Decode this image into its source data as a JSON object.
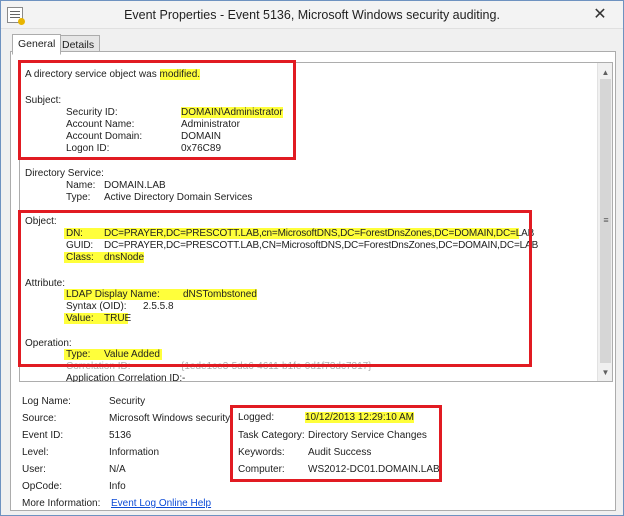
{
  "window": {
    "title": "Event Properties - Event 5136, Microsoft Windows security auditing.",
    "close_glyph": "✕"
  },
  "tabs": [
    {
      "label": "General",
      "active": true
    },
    {
      "label": "Details",
      "active": false
    }
  ],
  "description": {
    "intro_prefix": "A directory service object was ",
    "intro_highlight": "modified.",
    "subject": {
      "heading": "Subject:",
      "security_id_label": "Security ID:",
      "security_id_value": "DOMAIN\\Administrator",
      "account_name_label": "Account Name:",
      "account_name_value": "Administrator",
      "account_domain_label": "Account Domain:",
      "account_domain_value": "DOMAIN",
      "logon_id_label": "Logon ID:",
      "logon_id_value": "0x76C89"
    },
    "directory_service": {
      "heading": "Directory Service:",
      "name_label": "Name:",
      "name_value": "DOMAIN.LAB",
      "type_label": "Type:",
      "type_value": "Active Directory Domain Services"
    },
    "object": {
      "heading": "Object:",
      "dn_label": "DN:",
      "dn_value": "DC=PRAYER,DC=PRESCOTT.LAB,cn=MicrosoftDNS,DC=ForestDnsZones,DC=DOMAIN,DC=LAB",
      "guid_label": "GUID:",
      "guid_value": "DC=PRAYER,DC=PRESCOTT.LAB,CN=MicrosoftDNS,DC=ForestDnsZones,DC=DOMAIN,DC=LAB",
      "class_label": "Class:",
      "class_value": "dnsNode"
    },
    "attribute": {
      "heading": "Attribute:",
      "ldap_label": "LDAP Display Name:",
      "ldap_value": "dNSTombstoned",
      "syntax_label": "Syntax (OID):",
      "syntax_value": "2.5.5.8",
      "value_label": "Value:",
      "value_value": "TRUE"
    },
    "operation": {
      "heading": "Operation:",
      "type_label": "Type:",
      "type_value": "Value Added",
      "correlation_label": "Correlation ID:",
      "correlation_value": "{1ede1ce3-5da6-4611-b1fe-0d1f73dc7317}",
      "app_correlation_label": "Application Correlation ID:",
      "app_correlation_value": "-"
    }
  },
  "details": {
    "log_name_label": "Log Name:",
    "log_name_value": "Security",
    "source_label": "Source:",
    "source_value": "Microsoft Windows security",
    "event_id_label": "Event ID:",
    "event_id_value": "5136",
    "level_label": "Level:",
    "level_value": "Information",
    "user_label": "User:",
    "user_value": "N/A",
    "opcode_label": "OpCode:",
    "opcode_value": "Info",
    "more_info_label": "More Information:",
    "more_info_link": "Event Log Online Help",
    "logged_label": "Logged:",
    "logged_value": "10/12/2013 12:29:10 AM",
    "task_category_label": "Task Category:",
    "task_category_value": "Directory Service Changes",
    "keywords_label": "Keywords:",
    "keywords_value": "Audit Success",
    "computer_label": "Computer:",
    "computer_value": "WS2012-DC01.DOMAIN.LAB"
  },
  "scrollbar": {
    "up_glyph": "▲",
    "down_glyph": "▼",
    "grip_glyph": "≡"
  },
  "colors": {
    "highlight": "#ffff3b",
    "annotation_red": "#e11b22",
    "link": "#0b4ad6"
  }
}
